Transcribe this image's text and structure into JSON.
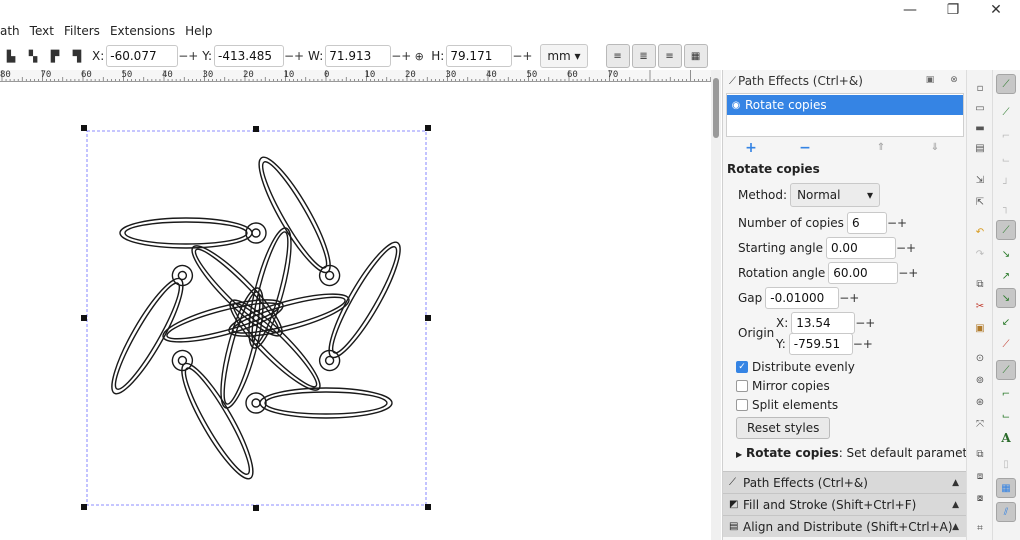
{
  "menu": [
    "ath",
    "Text",
    "Filters",
    "Extensions",
    "Help"
  ],
  "toolbar": {
    "x_label": "X:",
    "x_value": "-60.077",
    "y_label": "Y:",
    "y_value": "-413.485",
    "w_label": "W:",
    "w_value": "71.913",
    "h_label": "H:",
    "h_value": "79.171",
    "unit": "mm",
    "minus": "−",
    "plus": "+",
    "lock_icon": "lock-icon"
  },
  "ruler": {
    "labels": [
      "80",
      "70",
      "60",
      "50",
      "40",
      "30",
      "20",
      "10",
      "0",
      "10",
      "20",
      "30",
      "40",
      "50",
      "60",
      "70"
    ]
  },
  "panel": {
    "header_title": "Path Effects (Ctrl+&)",
    "effect_item": "Rotate copies",
    "effect_title": "Rotate copies",
    "method_label": "Method:",
    "method_value": "Normal",
    "num_copies_label": "Number of copies",
    "num_copies_value": "6",
    "starting_angle_label": "Starting angle",
    "starting_angle_value": "0.00",
    "rotation_angle_label": "Rotation angle",
    "rotation_angle_value": "60.00",
    "gap_label": "Gap",
    "gap_value": "-0.01000",
    "origin_label": "Origin",
    "origin_x_label": "X:",
    "origin_x_value": "13.54",
    "origin_y_label": "Y:",
    "origin_y_value": "-759.51",
    "distribute_label": "Distribute evenly",
    "distribute_checked": true,
    "mirror_label": "Mirror copies",
    "mirror_checked": false,
    "split_label": "Split elements",
    "split_checked": false,
    "reset_label": "Reset styles",
    "hint_bold": "Rotate copies",
    "hint_rest": ": Set default parameters",
    "minus": "−",
    "plus": "+"
  },
  "dock_tabs": [
    {
      "label": "Path Effects (Ctrl+&)",
      "icon": "path-effects-icon"
    },
    {
      "label": "Fill and Stroke (Shift+Ctrl+F)",
      "icon": "fill-stroke-icon"
    },
    {
      "label": "Align and Distribute (Shift+Ctrl+A)",
      "icon": "align-icon"
    }
  ],
  "colors": {
    "selection": "#3584e4",
    "drawing_stroke": "#1a1a1a",
    "bbox_dash": "#6a6aff",
    "text_tool_a": "#2a6a2a"
  }
}
